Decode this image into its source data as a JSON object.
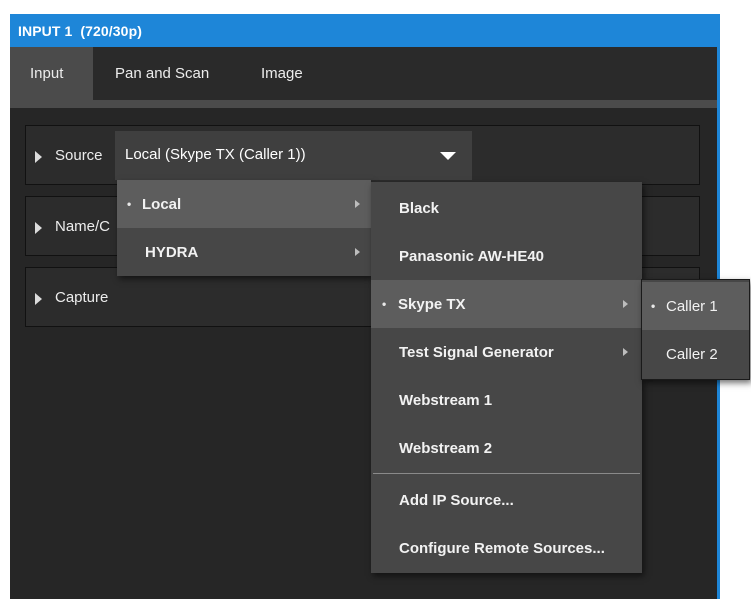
{
  "window": {
    "title_a": "INPUT 1",
    "title_b": "(720/30p)"
  },
  "tabs": [
    {
      "label": "Input",
      "active": true
    },
    {
      "label": "Pan and Scan",
      "active": false
    },
    {
      "label": "Image",
      "active": false
    }
  ],
  "sections": {
    "source_label": "Source",
    "source_value": "Local (Skype TX (Caller 1))",
    "name_label": "Name/C",
    "capture_label": "Capture"
  },
  "menu1": {
    "items": [
      {
        "label": "Local",
        "selected": true,
        "has_submenu": true
      },
      {
        "label": "HYDRA",
        "selected": false,
        "has_submenu": true
      }
    ]
  },
  "menu2": {
    "items": [
      {
        "label": "Black"
      },
      {
        "label": "Panasonic AW-HE40"
      },
      {
        "label": "Skype TX",
        "selected": true,
        "has_submenu": true
      },
      {
        "label": "Test Signal Generator",
        "has_submenu": true
      },
      {
        "label": "Webstream 1"
      },
      {
        "label": "Webstream 2"
      },
      {
        "label": "Add IP Source..."
      },
      {
        "label": "Configure Remote Sources..."
      }
    ]
  },
  "menu3": {
    "items": [
      {
        "label": "Caller 1",
        "selected": true
      },
      {
        "label": "Caller 2"
      }
    ]
  },
  "icons": {
    "bullet": "•",
    "expand": "triangle-right",
    "dropdown": "triangle-down",
    "submenu": "chevron-right"
  },
  "colors": {
    "titlebar": "#1e86d8",
    "background": "#262626",
    "menu": "#474747",
    "menu_highlight": "#5d5d5d"
  }
}
